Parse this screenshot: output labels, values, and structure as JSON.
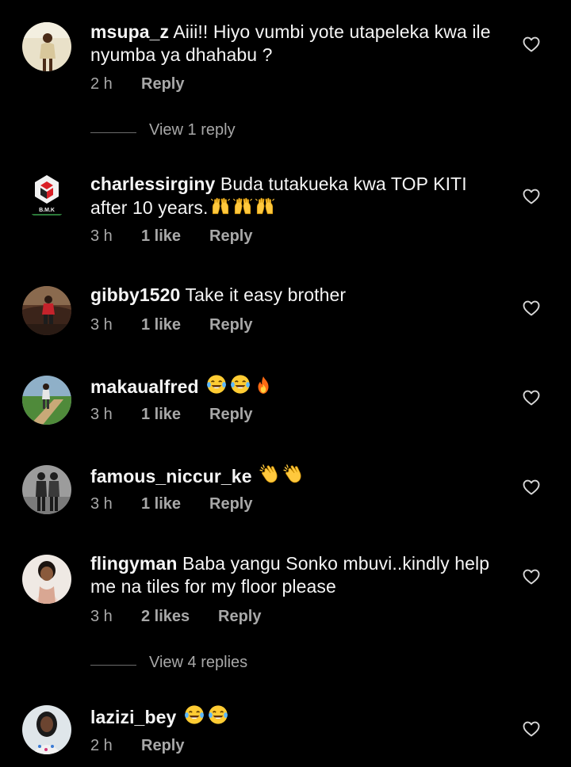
{
  "colors": {
    "background": "#000000",
    "text": "#f5f5f5",
    "muted": "#a8a8a8",
    "fire": "#ff7a1a",
    "clap_yellow": "#ffc83d"
  },
  "comments": [
    {
      "username": "msupa_z",
      "text": "Aiii!! Hiyo vumbi  yote utapeleka kwa ile nyumba ya dhahabu ?",
      "time": "2 h",
      "likes": "",
      "reply": "Reply",
      "emojis": []
    },
    {
      "username": "charlessirginy",
      "text": "Buda tutakueka kwa TOP KITI after 10 years.",
      "time": "3 h",
      "likes": "1 like",
      "reply": "Reply",
      "emojis": [
        "raising-hands-icon",
        "raising-hands-icon",
        "raising-hands-icon"
      ],
      "avatar_label": "B.M.K"
    },
    {
      "username": "gibby1520",
      "text": "Take it easy brother",
      "time": "3 h",
      "likes": "1 like",
      "reply": "Reply",
      "emojis": []
    },
    {
      "username": "makaualfred",
      "text": "",
      "time": "3 h",
      "likes": "1 like",
      "reply": "Reply",
      "emojis": [
        "tears-of-joy-icon",
        "tears-of-joy-icon",
        "fire-icon"
      ]
    },
    {
      "username": "famous_niccur_ke",
      "text": "",
      "time": "3 h",
      "likes": "1 like",
      "reply": "Reply",
      "emojis": [
        "clapping-hands-icon",
        "clapping-hands-icon"
      ]
    },
    {
      "username": "flingyman",
      "text": "Baba yangu Sonko mbuvi..kindly help me na tiles for my floor please",
      "time": "3 h",
      "likes": "2 likes",
      "reply": "Reply",
      "emojis": []
    },
    {
      "username": "lazizi_bey",
      "text": "",
      "time": "2 h",
      "likes": "",
      "reply": "Reply",
      "emojis": [
        "tears-of-joy-icon",
        "tears-of-joy-icon"
      ]
    }
  ],
  "view_replies": [
    {
      "label": "View 1 reply"
    },
    {
      "label": "View 4 replies"
    }
  ]
}
